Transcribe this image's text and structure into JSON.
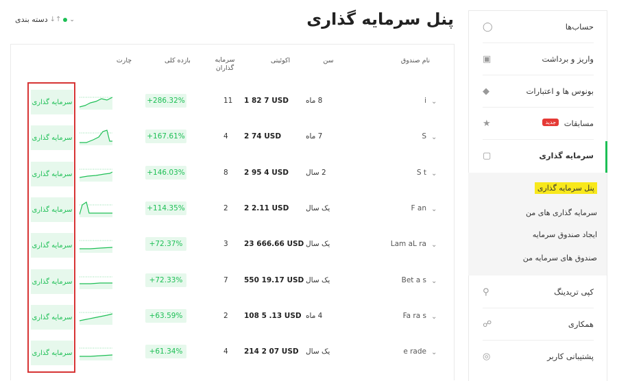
{
  "page": {
    "title": "پنل سرمایه گذاری"
  },
  "sort": {
    "label": "دسته بندی",
    "status_color": "#1dbf55"
  },
  "sidebar": {
    "items": [
      {
        "label": "حساب‌ها",
        "icon": "wallet-icon"
      },
      {
        "label": "واریز و برداشت",
        "icon": "cash-icon"
      },
      {
        "label": "بونوس ها و اعتبارات",
        "icon": "gift-icon"
      },
      {
        "label": "مسابقات",
        "icon": "trophy-icon",
        "badge": "جدید"
      },
      {
        "label": "سرمایه گذاری",
        "icon": "briefcase-icon",
        "active": true
      },
      {
        "label": "کپی تریدینگ",
        "icon": "copy-trading-icon"
      },
      {
        "label": "همکاری",
        "icon": "handshake-icon"
      },
      {
        "label": "پشتیبانی کاربر",
        "icon": "headset-icon"
      }
    ],
    "submenu": [
      {
        "label": "پنل سرمایه گذاری",
        "highlighted": true
      },
      {
        "label": "سرمایه گذاری های من"
      },
      {
        "label": "ایجاد صندوق سرمایه"
      },
      {
        "label": "صندوق های سرمایه من"
      }
    ]
  },
  "table": {
    "headers": {
      "name": "نام صندوق",
      "age": "سن",
      "equity": "اکوئیتی",
      "investors": "سرمایه گذاران",
      "return": "بازده کلی",
      "chart": "چارت"
    },
    "invest_label": "سرمایه گذاری",
    "rows": [
      {
        "name": "i",
        "age": "8 ماه",
        "equity": "1 82    7 USD",
        "investors": "11",
        "return": "+286.32%"
      },
      {
        "name": "S",
        "age": "7 ماه",
        "equity": "2     74 USD",
        "investors": "4",
        "return": "+167.61%"
      },
      {
        "name": "S     t",
        "age": "2 سال",
        "equity": "2 95   4 USD",
        "investors": "8",
        "return": "+146.03%"
      },
      {
        "name": "F     an",
        "age": "یک سال",
        "equity": "2     2.11 USD",
        "investors": "2",
        "return": "+114.35%"
      },
      {
        "name": "Lam   aL    ra",
        "age": "یک سال",
        "equity": "23   666.66 USD",
        "investors": "3",
        "return": "+72.37%"
      },
      {
        "name": "Bet     a     s",
        "age": "یک سال",
        "equity": "550   19.17 USD",
        "investors": "7",
        "return": "+72.33%"
      },
      {
        "name": "Fa          ra   s",
        "age": "4 ماه",
        "equity": "108 5    .13 USD",
        "investors": "2",
        "return": "+63.59%"
      },
      {
        "name": "e    rade",
        "age": "یک سال",
        "equity": "214 2    07 USD",
        "investors": "4",
        "return": "+61.34%"
      }
    ]
  },
  "colors": {
    "accent": "#1dbf55",
    "highlight": "#f8e81c",
    "outline": "#d63333"
  }
}
